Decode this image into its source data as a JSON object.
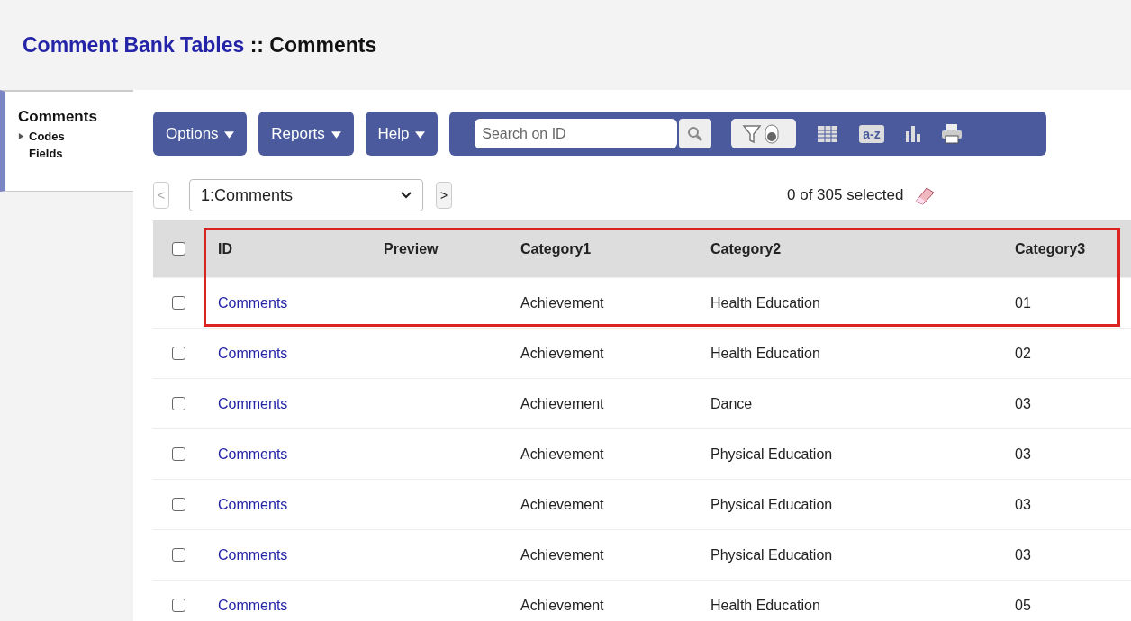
{
  "header": {
    "title_link": "Comment Bank Tables",
    "title_rest": " :: Comments"
  },
  "sidebar": {
    "heading": "Comments",
    "items": [
      {
        "label": "Codes",
        "expanded": false,
        "kind": "expandable"
      },
      {
        "label": "Fields",
        "kind": "plain"
      }
    ]
  },
  "toolbar": {
    "menus": [
      "Options",
      "Reports",
      "Help"
    ],
    "search": {
      "placeholder": "Search on ID"
    },
    "filter_on": false,
    "sort_label": "a-z"
  },
  "nav": {
    "prev": "<",
    "next": ">",
    "view": "1:Comments",
    "selection": "0 of 305 selected"
  },
  "table": {
    "highlight": true,
    "all_checked": false,
    "columns": [
      "ID",
      "Preview",
      "Category1",
      "Category2",
      "Category3"
    ],
    "rows": [
      {
        "checked": false,
        "cells": [
          "Comments",
          "",
          "Achievement",
          "Health Education",
          "01"
        ]
      },
      {
        "checked": false,
        "cells": [
          "Comments",
          "",
          "Achievement",
          "Health Education",
          "02"
        ]
      },
      {
        "checked": false,
        "cells": [
          "Comments",
          "",
          "Achievement",
          "Dance",
          "03"
        ]
      },
      {
        "checked": false,
        "cells": [
          "Comments",
          "",
          "Achievement",
          "Physical Education",
          "03"
        ]
      },
      {
        "checked": false,
        "cells": [
          "Comments",
          "",
          "Achievement",
          "Physical Education",
          "03"
        ]
      },
      {
        "checked": false,
        "cells": [
          "Comments",
          "",
          "Achievement",
          "Physical Education",
          "03"
        ]
      },
      {
        "checked": false,
        "cells": [
          "Comments",
          "",
          "Achievement",
          "Health Education",
          "05"
        ]
      }
    ]
  }
}
